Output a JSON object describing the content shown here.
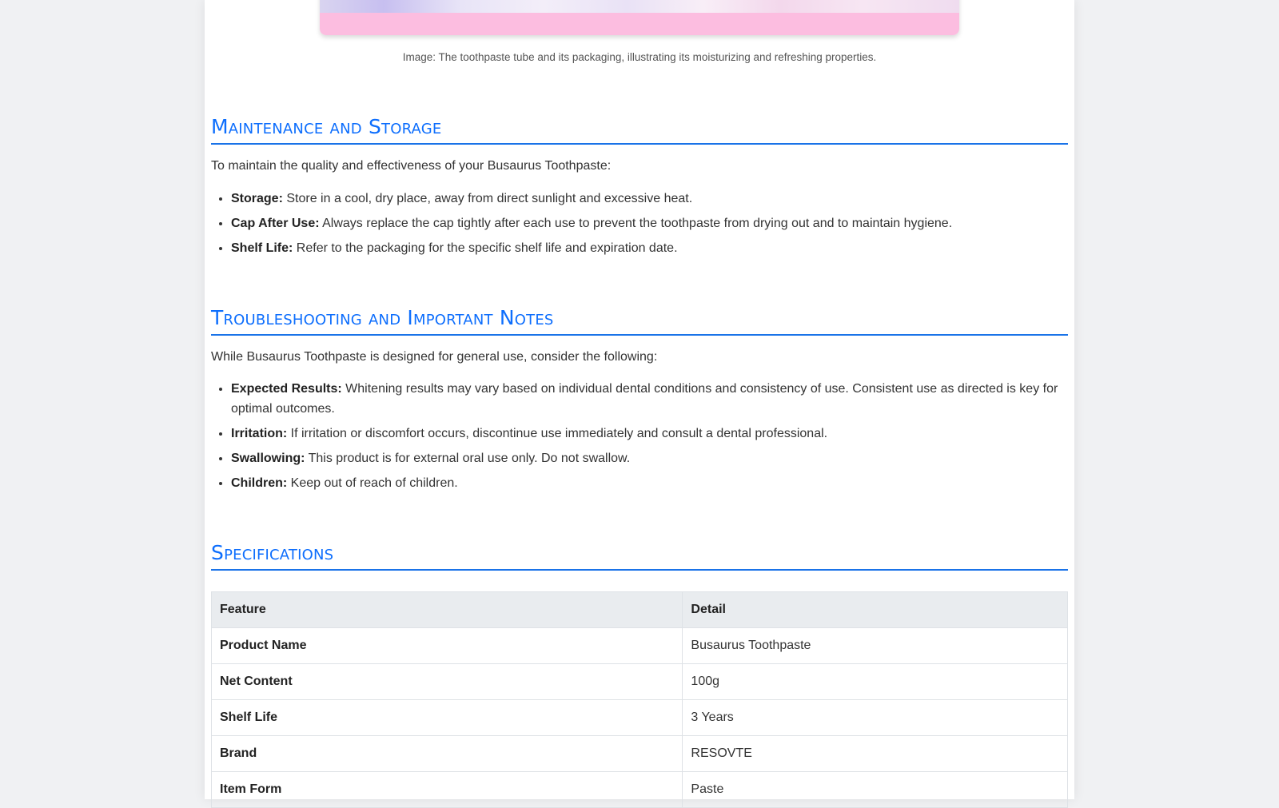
{
  "image": {
    "caption": "Image: The toothpaste tube and its packaging, illustrating its moisturizing and refreshing properties."
  },
  "maintenance": {
    "title": "Maintenance and Storage",
    "intro": "To maintain the quality and effectiveness of your Busaurus Toothpaste:",
    "items": [
      {
        "label": "Storage:",
        "text": " Store in a cool, dry place, away from direct sunlight and excessive heat."
      },
      {
        "label": "Cap After Use:",
        "text": " Always replace the cap tightly after each use to prevent the toothpaste from drying out and to maintain hygiene."
      },
      {
        "label": "Shelf Life:",
        "text": " Refer to the packaging for the specific shelf life and expiration date."
      }
    ]
  },
  "troubleshooting": {
    "title": "Troubleshooting and Important Notes",
    "intro": "While Busaurus Toothpaste is designed for general use, consider the following:",
    "items": [
      {
        "label": "Expected Results:",
        "text": " Whitening results may vary based on individual dental conditions and consistency of use. Consistent use as directed is key for optimal outcomes."
      },
      {
        "label": "Irritation:",
        "text": " If irritation or discomfort occurs, discontinue use immediately and consult a dental professional."
      },
      {
        "label": "Swallowing:",
        "text": " This product is for external oral use only. Do not swallow."
      },
      {
        "label": "Children:",
        "text": " Keep out of reach of children."
      }
    ]
  },
  "specifications": {
    "title": "Specifications",
    "headers": [
      "Feature",
      "Detail"
    ],
    "rows": [
      {
        "feature": "Product Name",
        "detail": "Busaurus Toothpaste"
      },
      {
        "feature": "Net Content",
        "detail": "100g"
      },
      {
        "feature": "Shelf Life",
        "detail": "3 Years"
      },
      {
        "feature": "Brand",
        "detail": "RESOVTE"
      },
      {
        "feature": "Item Form",
        "detail": "Paste"
      }
    ]
  },
  "colors": {
    "accent": "#0d6efd",
    "rule": "#1a73e8",
    "table_header_bg": "#e9ecef",
    "image_band": "#fcbde0"
  }
}
